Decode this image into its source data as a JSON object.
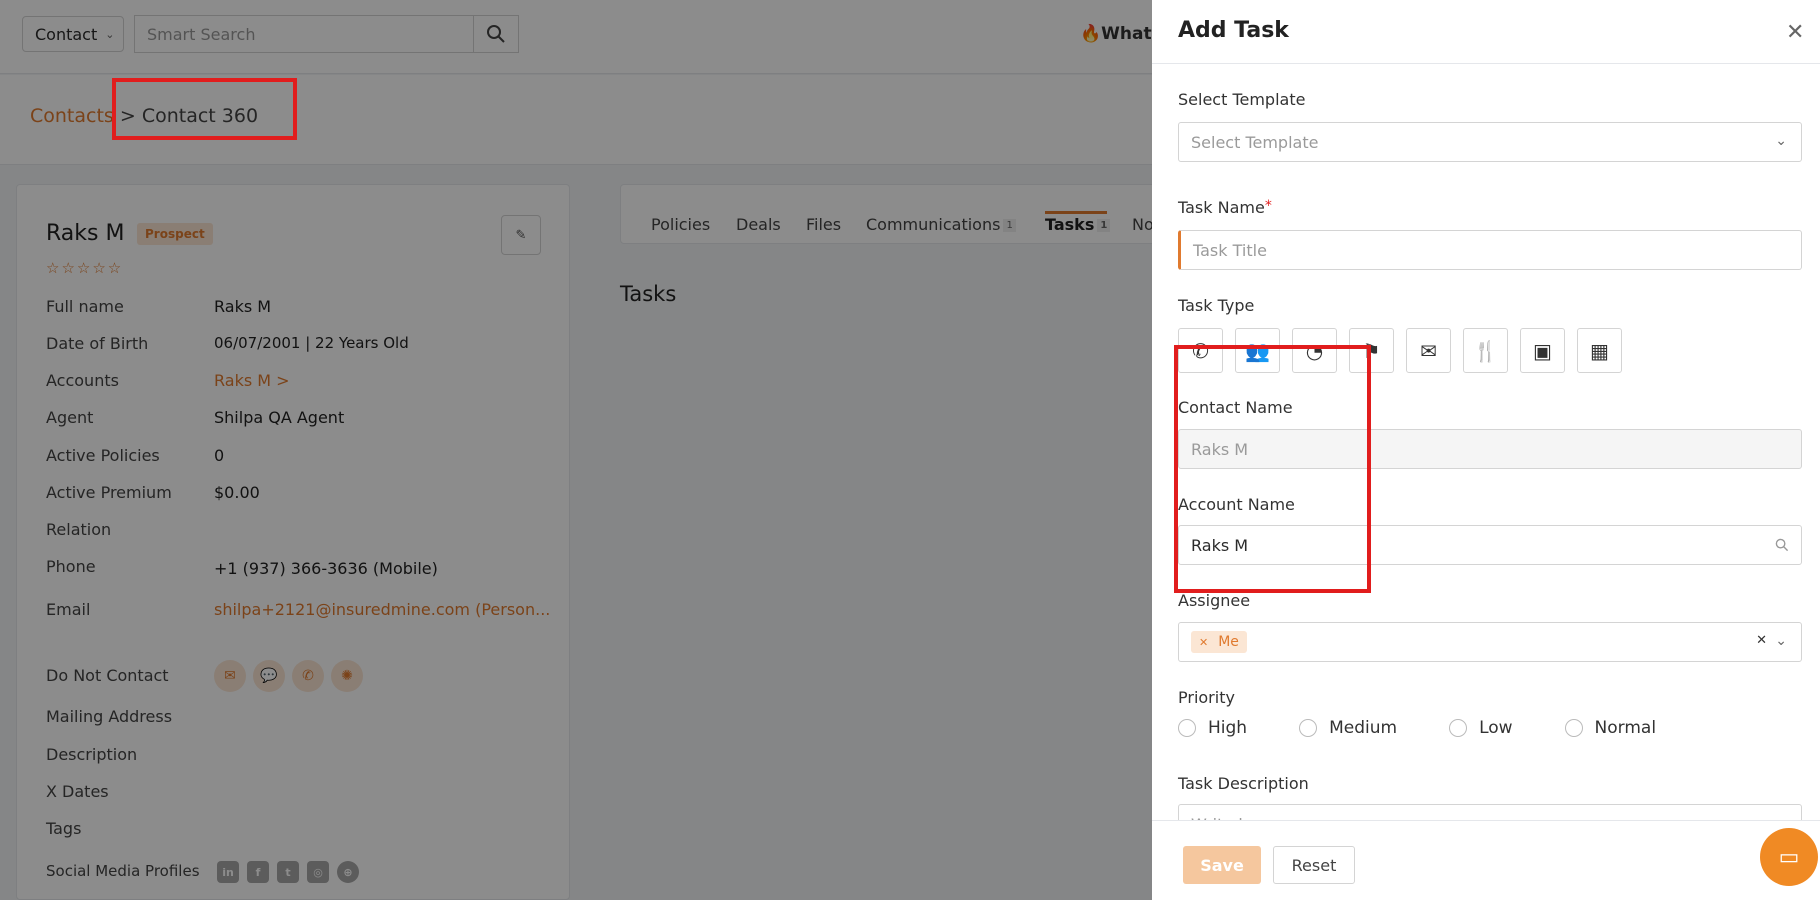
{
  "header": {
    "contact_dropdown": "Contact",
    "search_placeholder": "Smart Search",
    "whats_new": "What's"
  },
  "breadcrumb": {
    "link": "Contacts",
    "separator": " > ",
    "current": "Contact 360"
  },
  "contact": {
    "name": "Raks M",
    "status_badge": "Prospect",
    "stars": "☆☆☆☆☆",
    "edit_icon": "pencil-icon",
    "fields": {
      "full_name": {
        "label": "Full name",
        "value": "Raks M"
      },
      "dob": {
        "label": "Date of Birth",
        "value": "06/07/2001 | 22 Years Old"
      },
      "accounts": {
        "label": "Accounts",
        "value": "Raks M >"
      },
      "agent": {
        "label": "Agent",
        "value": "Shilpa QA Agent"
      },
      "active_policies": {
        "label": "Active Policies",
        "value": "0"
      },
      "active_premium": {
        "label": "Active Premium",
        "value": "$0.00"
      },
      "relation": {
        "label": "Relation",
        "value": ""
      },
      "phone": {
        "label": "Phone",
        "value": "+1 (937) 366-3636 (Mobile)"
      },
      "email": {
        "label": "Email",
        "value": "shilpa+2121@insuredmine.com  (Person..."
      },
      "do_not_contact": {
        "label": "Do Not Contact"
      },
      "mailing_address": {
        "label": "Mailing Address"
      },
      "description": {
        "label": "Description"
      },
      "x_dates": {
        "label": "X Dates"
      },
      "tags": {
        "label": "Tags"
      },
      "social": {
        "label": "Social Media Profiles"
      }
    },
    "dnc_icons": [
      "email-icon",
      "chat-icon",
      "phone-icon",
      "broadcast-icon"
    ],
    "social_icons": [
      "linkedin-icon",
      "facebook-icon",
      "twitter-icon",
      "instagram-icon",
      "globe-icon"
    ]
  },
  "tabs": {
    "policies": "Policies",
    "deals": "Deals",
    "files": "Files",
    "communications": "Communications",
    "communications_count": "1",
    "tasks": "Tasks",
    "tasks_count": "1",
    "notes": "No"
  },
  "main": {
    "tasks_heading": "Tasks"
  },
  "drawer": {
    "title": "Add Task",
    "close_icon": "close-icon",
    "select_template_label": "Select Template",
    "select_template_placeholder": "Select Template",
    "task_name_label": "Task Name",
    "task_name_required": "*",
    "task_name_placeholder": "Task Title",
    "task_type_label": "Task Type",
    "task_types": [
      "phone-icon",
      "meeting-icon",
      "clock-icon",
      "flag-icon",
      "email-icon",
      "lunch-icon",
      "wallet-icon",
      "dashboard-icon"
    ],
    "contact_name_label": "Contact Name",
    "contact_name_value": "Raks M",
    "account_name_label": "Account Name",
    "account_name_value": "Raks M",
    "assignee_label": "Assignee",
    "assignee_tag": "Me",
    "priority_label": "Priority",
    "priority_options": {
      "high": "High",
      "medium": "Medium",
      "low": "Low",
      "normal": "Normal"
    },
    "task_description_label": "Task Description",
    "task_description_placeholder": "Write here...",
    "save_label": "Save",
    "reset_label": "Reset"
  },
  "colors": {
    "accent": "#e07a2f",
    "highlight": "#e11d1d"
  }
}
